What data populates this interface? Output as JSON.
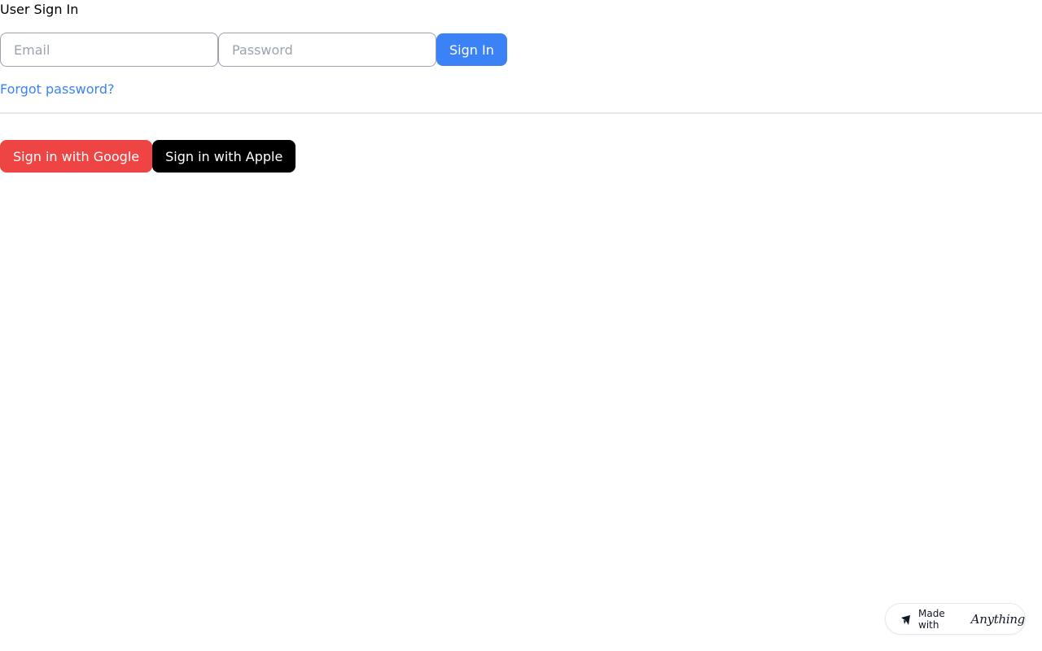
{
  "header": {
    "title": "User Sign In"
  },
  "form": {
    "email_placeholder": "Email",
    "email_value": "",
    "password_placeholder": "Password",
    "password_value": "",
    "sign_in_label": "Sign In",
    "forgot_label": "Forgot password?"
  },
  "social": {
    "google_label": "Sign in with Google",
    "apple_label": "Sign in with Apple"
  },
  "badge": {
    "prefix": "Made with",
    "brand": "Anything",
    "icon": "anything-logo-icon"
  },
  "colors": {
    "primary": "#3b82f6",
    "google": "#ef4444",
    "apple": "#000000",
    "link": "#3b82f6"
  }
}
